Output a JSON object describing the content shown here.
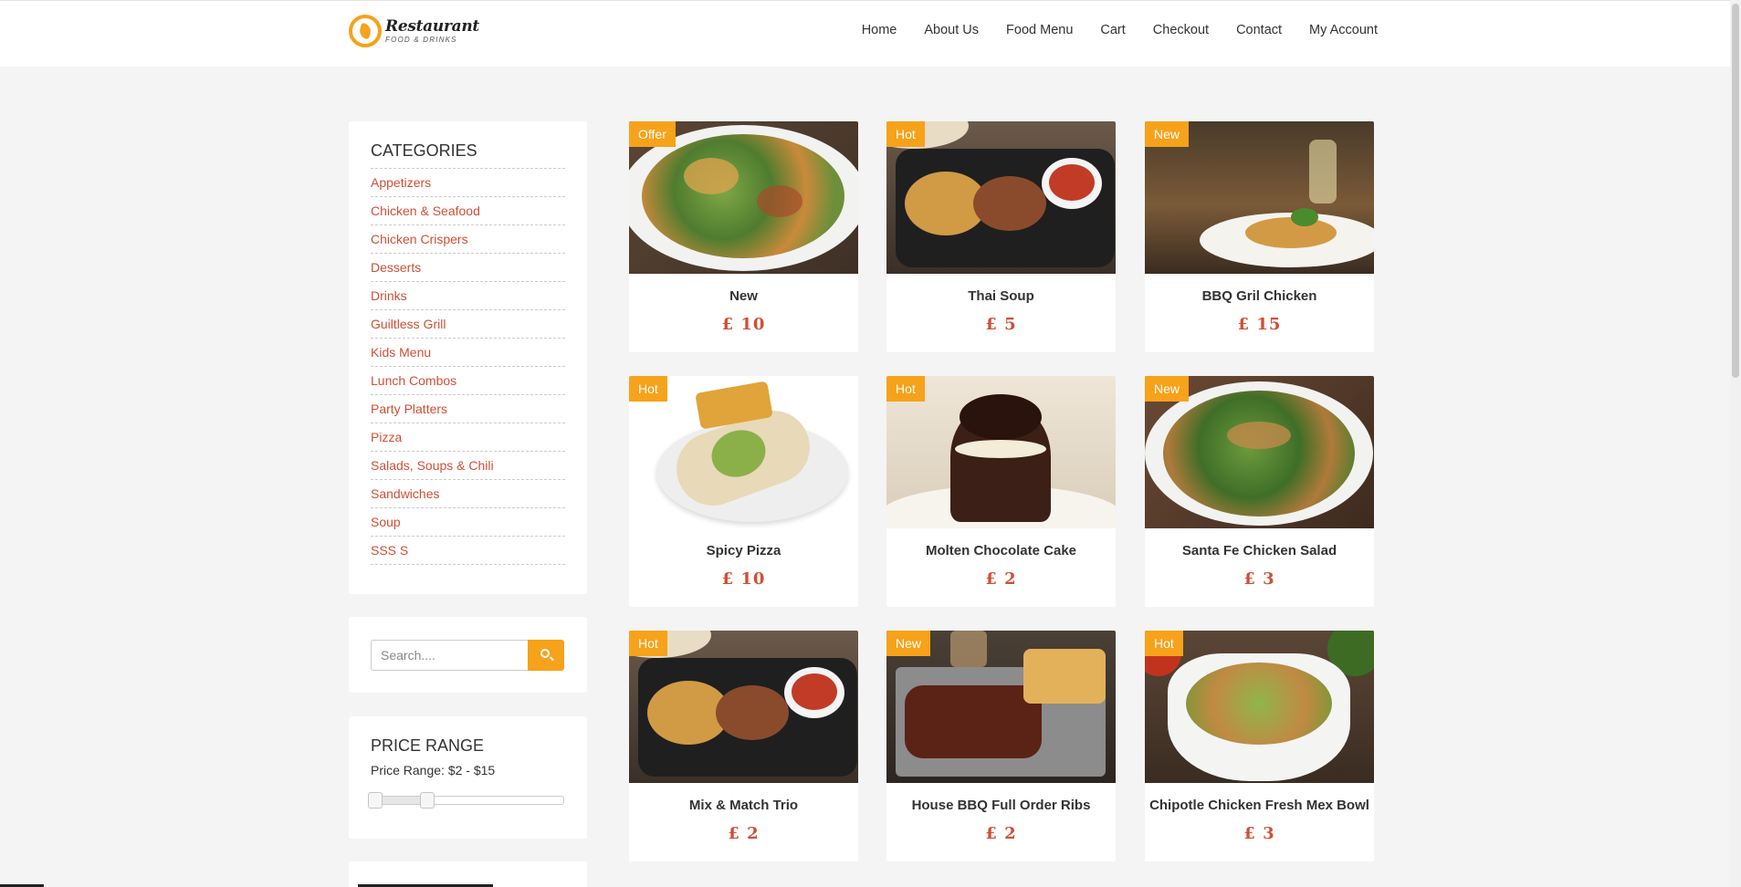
{
  "brand": {
    "title": "Restaurant",
    "subtitle": "FOOD & DRINKS"
  },
  "nav": [
    "Home",
    "About Us",
    "Food Menu",
    "Cart",
    "Checkout",
    "Contact",
    "My Account"
  ],
  "categories": {
    "title": "CATEGORIES",
    "items": [
      "Appetizers",
      "Chicken & Seafood",
      "Chicken Crispers",
      "Desserts",
      "Drinks",
      "Guiltless Grill",
      "Kids Menu",
      "Lunch Combos",
      "Party Platters",
      "Pizza",
      "Salads, Soups & Chili",
      "Sandwiches",
      "Soup",
      "SSS S"
    ]
  },
  "search": {
    "placeholder": "Search....",
    "value": "",
    "icon": "search-icon"
  },
  "price_range": {
    "title": "PRICE RANGE",
    "label": "Price Range: $2 - $15",
    "min": 2,
    "max": 15
  },
  "colors": {
    "accent": "#f6a21a",
    "price": "#d04f36",
    "link": "#d04f36",
    "background": "#f4f4f4"
  },
  "products": [
    {
      "name": "New",
      "price": "£ 10",
      "badge": "Offer"
    },
    {
      "name": "Thai Soup",
      "price": "£ 5",
      "badge": "Hot"
    },
    {
      "name": "BBQ Gril Chicken",
      "price": "£ 15",
      "badge": "New"
    },
    {
      "name": "Spicy Pizza",
      "price": "£ 10",
      "badge": "Hot"
    },
    {
      "name": "Molten Chocolate Cake",
      "price": "£ 2",
      "badge": "Hot"
    },
    {
      "name": "Santa Fe Chicken Salad",
      "price": "£ 3",
      "badge": "New"
    },
    {
      "name": "Mix & Match Trio",
      "price": "£ 2",
      "badge": "Hot"
    },
    {
      "name": "House BBQ Full Order Ribs",
      "price": "£ 2",
      "badge": "New"
    },
    {
      "name": "Chipotle Chicken Fresh Mex Bowl",
      "price": "£ 3",
      "badge": "Hot"
    }
  ]
}
